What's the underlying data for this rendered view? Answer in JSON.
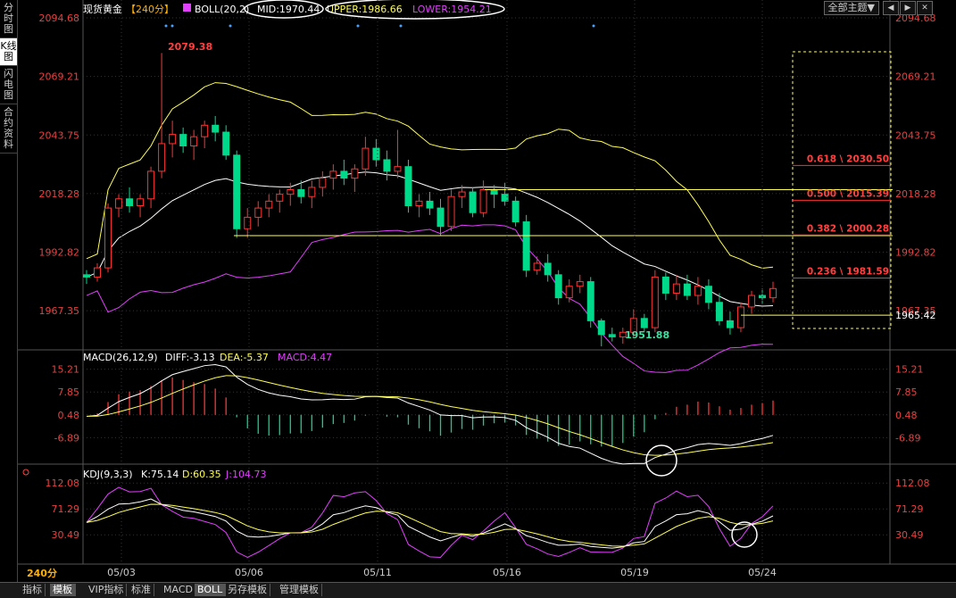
{
  "sidebar": {
    "tabs": [
      {
        "label": "分时图",
        "active": false
      },
      {
        "label": "K线图",
        "active": true
      },
      {
        "label": "闪电图",
        "active": false
      },
      {
        "label": "合约资料",
        "active": false
      }
    ]
  },
  "topbar": {
    "theme_label": "全部主题▼",
    "btn_prev": "◀",
    "btn_next": "▶",
    "btn_close": "✕"
  },
  "bottom": {
    "period": "240分",
    "tabs": [
      "指标",
      "模板",
      "VIP指标",
      "标准",
      "MACD",
      "BOLL",
      "另存模板",
      "管理模板"
    ],
    "active": [
      1,
      5
    ]
  },
  "chart_data": [
    {
      "type": "candlestick",
      "panel": "main",
      "header": {
        "name": "现货黄金",
        "period": "【240分】",
        "indicator": "BOLL(20,2)",
        "mid": "MID:1970.44",
        "upper": "UPPER:1986.66",
        "lower": "LOWER:1954.21"
      },
      "y_ticks": [
        "2094.68",
        "2069.21",
        "2043.75",
        "2018.28",
        "1992.82",
        "1967.35"
      ],
      "ylim": [
        1955,
        2094.68
      ],
      "x_ticks": [
        "05/03",
        "05/06",
        "05/11",
        "05/16",
        "05/19",
        "05/24"
      ],
      "annotations": {
        "high": "2079.38",
        "low": "1951.88",
        "last": "1965.42"
      },
      "fib": [
        {
          "label": "0.618 \\ 2030.50",
          "value": 2030.5
        },
        {
          "label": "0.500 \\ 2015.39",
          "value": 2015.39
        },
        {
          "label": "0.382 \\ 2000.28",
          "value": 2000.28
        },
        {
          "label": "0.236 \\ 1981.59",
          "value": 1981.59
        }
      ],
      "ohlc": [
        [
          1983,
          1985,
          1979,
          1982
        ],
        [
          1982,
          1988,
          1980,
          1986
        ],
        [
          1986,
          2014,
          1984,
          2012
        ],
        [
          2012,
          2018,
          2008,
          2016
        ],
        [
          2016,
          2021,
          2010,
          2013
        ],
        [
          2013,
          2018,
          2008,
          2016
        ],
        [
          2016,
          2030,
          2012,
          2028
        ],
        [
          2028,
          2079.38,
          2025,
          2040
        ],
        [
          2040,
          2050,
          2034,
          2044
        ],
        [
          2044,
          2047,
          2036,
          2039
        ],
        [
          2039,
          2046,
          2033,
          2043
        ],
        [
          2043,
          2050,
          2038,
          2048
        ],
        [
          2048,
          2052,
          2041,
          2045
        ],
        [
          2045,
          2048,
          2033,
          2035
        ],
        [
          2035,
          2037,
          1999,
          2003
        ],
        [
          2003,
          2012,
          1999,
          2008
        ],
        [
          2008,
          2015,
          2004,
          2012
        ],
        [
          2012,
          2018,
          2008,
          2015
        ],
        [
          2015,
          2020,
          2010,
          2018
        ],
        [
          2018,
          2023,
          2013,
          2020
        ],
        [
          2020,
          2024,
          2014,
          2017
        ],
        [
          2017,
          2024,
          2012,
          2021
        ],
        [
          2021,
          2028,
          2017,
          2025
        ],
        [
          2025,
          2031,
          2020,
          2028
        ],
        [
          2028,
          2033,
          2022,
          2025
        ],
        [
          2025,
          2031,
          2019,
          2029
        ],
        [
          2029,
          2043,
          2026,
          2038
        ],
        [
          2038,
          2042,
          2030,
          2033
        ],
        [
          2033,
          2037,
          2024,
          2028
        ],
        [
          2028,
          2046,
          2025,
          2030
        ],
        [
          2030,
          2033,
          2010,
          2013
        ],
        [
          2013,
          2018,
          2008,
          2015
        ],
        [
          2015,
          2019,
          2009,
          2012
        ],
        [
          2012,
          2016,
          2000,
          2004
        ],
        [
          2004,
          2020,
          2002,
          2017
        ],
        [
          2017,
          2022,
          2012,
          2019
        ],
        [
          2019,
          2021,
          2008,
          2010
        ],
        [
          2010,
          2024,
          2008,
          2020
        ],
        [
          2020,
          2022,
          2012,
          2018
        ],
        [
          2018,
          2023,
          2013,
          2015
        ],
        [
          2015,
          2017,
          2004,
          2006
        ],
        [
          2006,
          2009,
          1982,
          1985
        ],
        [
          1985,
          1991,
          1983,
          1988
        ],
        [
          1988,
          1992,
          1980,
          1983
        ],
        [
          1983,
          1985,
          1970,
          1973
        ],
        [
          1973,
          1981,
          1971,
          1978
        ],
        [
          1978,
          1983,
          1975,
          1980
        ],
        [
          1980,
          1982,
          1960,
          1963
        ],
        [
          1963,
          1964,
          1951.88,
          1957
        ],
        [
          1957,
          1960,
          1954,
          1956
        ],
        [
          1956,
          1960,
          1953,
          1958
        ],
        [
          1958,
          1968,
          1956,
          1964
        ],
        [
          1964,
          1966,
          1958,
          1960
        ],
        [
          1960,
          1985,
          1958,
          1982
        ],
        [
          1982,
          1984,
          1972,
          1975
        ],
        [
          1975,
          1983,
          1972,
          1979
        ],
        [
          1979,
          1983,
          1972,
          1974
        ],
        [
          1974,
          1982,
          1970,
          1978
        ],
        [
          1978,
          1981,
          1968,
          1971
        ],
        [
          1971,
          1975,
          1961,
          1963
        ],
        [
          1963,
          1967,
          1957,
          1960
        ],
        [
          1960,
          1971,
          1958,
          1969
        ],
        [
          1969,
          1976,
          1966,
          1974
        ],
        [
          1974,
          1977,
          1970,
          1973
        ],
        [
          1973,
          1980,
          1971,
          1977
        ]
      ]
    },
    {
      "type": "macd",
      "panel": "macd",
      "header": {
        "label": "MACD(26,12,9)",
        "diff": "DIFF:-3.13",
        "dea": "DEA:-5.37",
        "macd": "MACD:4.47"
      },
      "y_ticks": [
        "15.21",
        "7.85",
        "0.48",
        "-6.89"
      ],
      "ylim": [
        -14,
        18
      ]
    },
    {
      "type": "kdj",
      "panel": "kdj",
      "header": {
        "label": "KDJ(9,3,3)",
        "k": "K:75.14",
        "d": "D:60.35",
        "j": "J:104.73"
      },
      "y_ticks": [
        "112.08",
        "71.29",
        "30.49"
      ],
      "ylim": [
        -10,
        125
      ]
    }
  ],
  "colors": {
    "up": "#ff3232",
    "down": "#00d98a",
    "boll_upper": "#ffff55",
    "boll_mid": "#ffffff",
    "boll_lower": "#e040fb",
    "fib": "#ff3030",
    "grid": "#333"
  }
}
